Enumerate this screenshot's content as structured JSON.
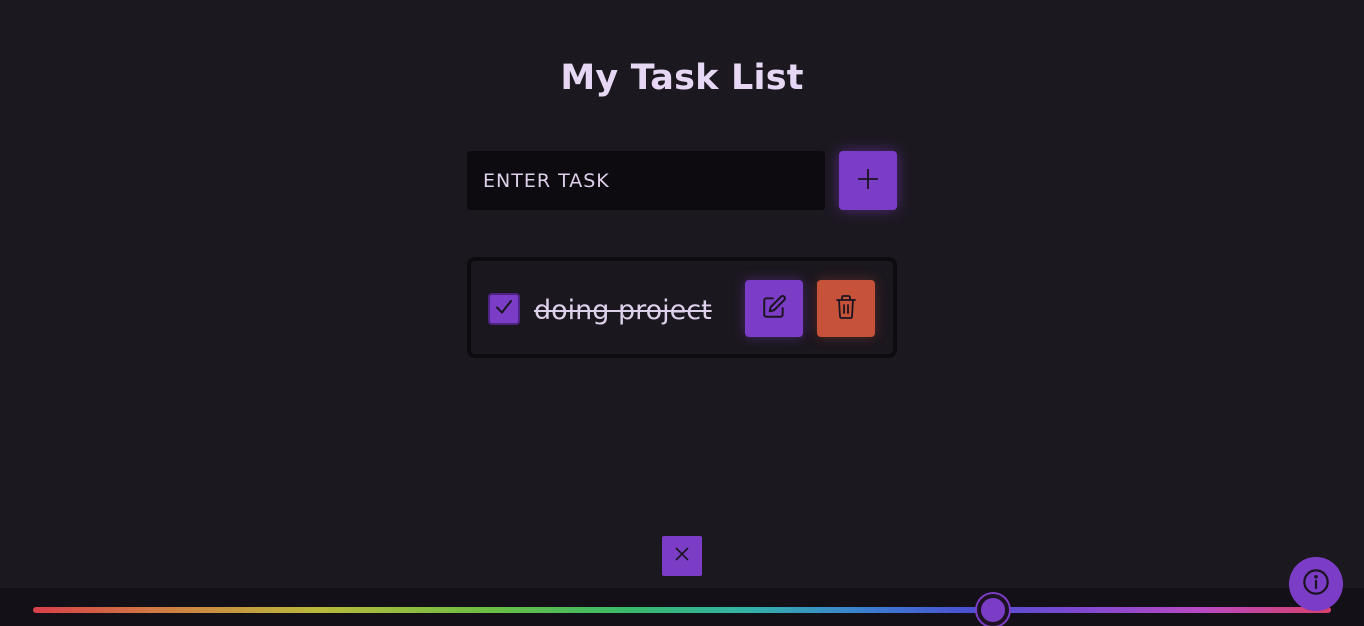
{
  "header": {
    "title": "My Task List"
  },
  "task_entry": {
    "placeholder": "ENTER TASK",
    "value": "",
    "add_icon": "plus-icon"
  },
  "tasks": [
    {
      "text": "doing project",
      "completed": true,
      "checkbox_icon": "checkmark-icon",
      "edit_icon": "pencil-square-icon",
      "delete_icon": "trash-icon"
    }
  ],
  "footer": {
    "close_icon": "close-icon",
    "info_icon": "info-icon",
    "color_slider": {
      "value_fraction": 0.74
    }
  },
  "colors": {
    "background": "#1c1820",
    "accent": "#7c3dc6",
    "danger": "#c7523a",
    "input_background": "#0d0a10",
    "text": "#e6d8f4"
  }
}
